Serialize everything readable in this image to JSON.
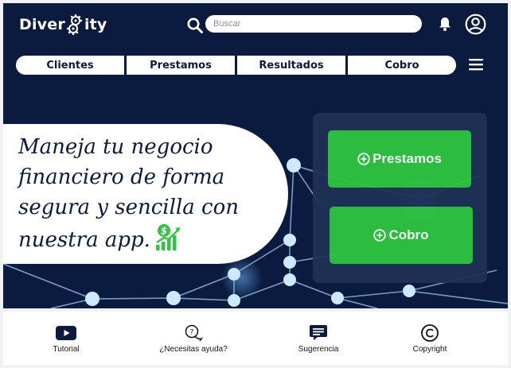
{
  "brand": {
    "logo_prefix": "Diver",
    "logo_suffix": "ity"
  },
  "search": {
    "placeholder": "Buscar",
    "value": ""
  },
  "nav": {
    "tabs": [
      "Clientes",
      "Prestamos",
      "Resultados",
      "Cobro"
    ]
  },
  "hero": {
    "line1": "Maneja tu negocio",
    "line2": "financiero de forma",
    "line3": "segura y sencilla con",
    "line4": "nuestra app."
  },
  "actions": {
    "primary": "Prestamos",
    "secondary": "Cobro"
  },
  "bottom_nav": {
    "items": [
      "Tutorial",
      "¿Necesitas ayuda?",
      "Sugerencia",
      "Copyright"
    ]
  },
  "colors": {
    "header_bg": "#0b1b3f",
    "accent_green": "#2ec540",
    "panel_bg": "#1f3256",
    "node": "#cde8ff"
  },
  "icons": [
    "search-icon",
    "bell-icon",
    "user-icon",
    "menu-icon",
    "money-growth-icon",
    "plus-circle-icon",
    "play-icon",
    "help-chat-icon",
    "suggestion-icon",
    "copyright-icon"
  ]
}
